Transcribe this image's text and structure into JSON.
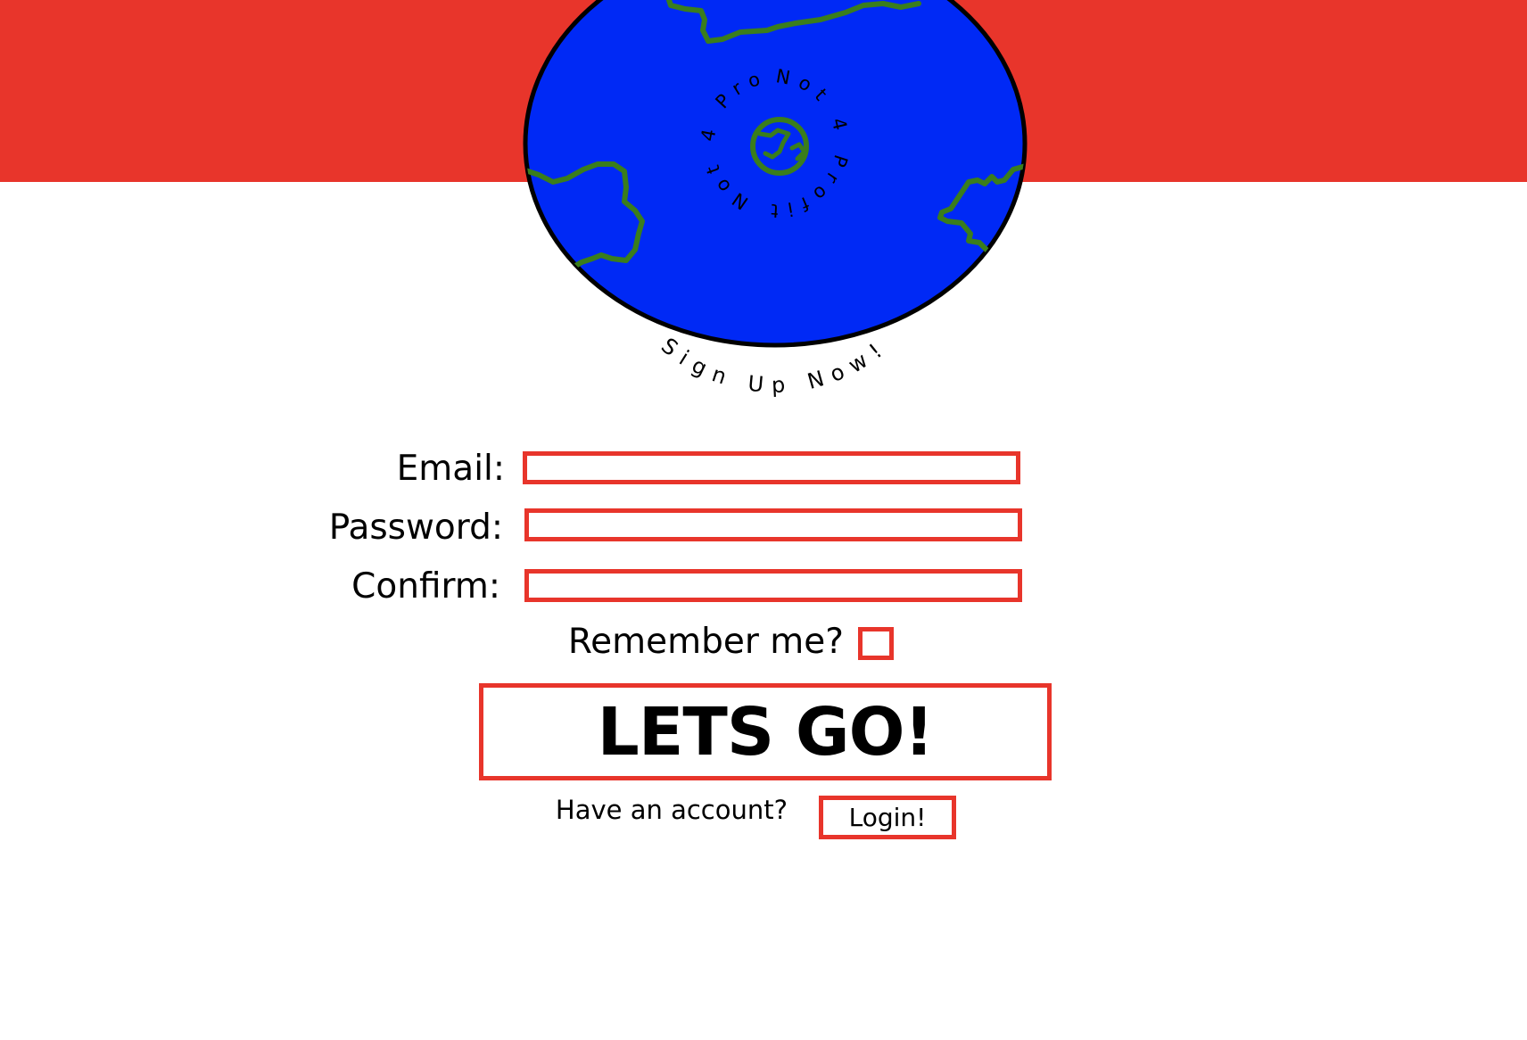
{
  "colors": {
    "band": "#e8352b",
    "globe_ocean": "#0029f5",
    "globe_land": "#3a7d1c",
    "accent_border": "#e8352b"
  },
  "logo": {
    "ring_text": "Not 4 Profit Not 4 Profit",
    "tagline": "Sign Up Now!",
    "icon": "globe-icon"
  },
  "form": {
    "email_label": "Email:",
    "email_value": "",
    "password_label": "Password:",
    "password_value": "",
    "confirm_label": "Confirm:",
    "confirm_value": "",
    "remember_label": "Remember me?",
    "remember_checked": false,
    "submit_label": "LETS GO!"
  },
  "footer": {
    "have_account": "Have an account?",
    "login_label": "Login!"
  }
}
